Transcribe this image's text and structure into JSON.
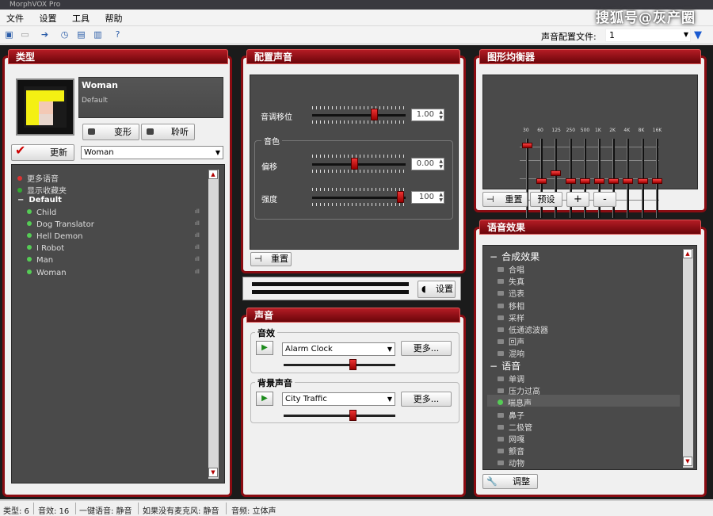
{
  "window": {
    "title": "MorphVOX Pro"
  },
  "watermark": "搜狐号@灰产圈",
  "menu": [
    "文件",
    "设置",
    "工具",
    "帮助"
  ],
  "toolbar": {
    "profile_label": "声音配置文件:",
    "profile_value": "1"
  },
  "type_panel": {
    "title": "类型",
    "voice_name": "Woman",
    "voice_subtitle": "Default",
    "morph_button": "变形",
    "listen_button": "聆听",
    "update_button": "更新",
    "voice_select": "Woman",
    "tree": {
      "more_voices": "更多语音",
      "show_favorites": "显示收藏夹",
      "group": "Default",
      "items": [
        "Child",
        "Dog Translator",
        "Hell Demon",
        "I Robot",
        "Man",
        "Woman"
      ]
    }
  },
  "config_panel": {
    "title": "配置声音",
    "pitch_label": "音调移位",
    "pitch_value": "1.00",
    "pitch_level": 0.68,
    "timbre_group": "音色",
    "bias_label": "偏移",
    "bias_value": "0.00",
    "bias_level": 0.45,
    "strength_label": "强度",
    "strength_value": "100",
    "strength_level": 0.98,
    "reset_button": "重置",
    "settings_button": "设置"
  },
  "sound_panel": {
    "title": "声音",
    "effects_group": "音效",
    "effect_select": "Alarm Clock",
    "effect_more": "更多...",
    "effect_volume": 0.63,
    "bg_group": "背景声音",
    "bg_select": "City Traffic",
    "bg_more": "更多...",
    "bg_volume": 0.63
  },
  "eq_panel": {
    "title": "图形均衡器",
    "bands": [
      {
        "freq": "30",
        "level": 0.95
      },
      {
        "freq": "60",
        "level": 0.48
      },
      {
        "freq": "125",
        "level": 0.58
      },
      {
        "freq": "250",
        "level": 0.48
      },
      {
        "freq": "500",
        "level": 0.48
      },
      {
        "freq": "1K",
        "level": 0.48
      },
      {
        "freq": "2K",
        "level": 0.48
      },
      {
        "freq": "4K",
        "level": 0.48
      },
      {
        "freq": "8K",
        "level": 0.48
      },
      {
        "freq": "16K",
        "level": 0.48
      }
    ],
    "reset_button": "重置",
    "preset_button": "预设",
    "plus_button": "+",
    "minus_button": "-"
  },
  "effects_panel": {
    "title": "语音效果",
    "group1": "合成效果",
    "group1_items": [
      "合唱",
      "失真",
      "迅表",
      "移相",
      "采样",
      "低通滤波器",
      "回声",
      "混响"
    ],
    "group2": "语音",
    "group2_items": [
      "单调",
      "压力过高",
      "喘息声",
      "鼻子",
      "二极管",
      "网嘎",
      "颤音",
      "动物"
    ],
    "tweak_button": "调整"
  },
  "statusbar": {
    "types": "类型: 6",
    "effects": "音效: 16",
    "hotkey": "一键语音: 静音",
    "nomic": "如果没有麦克风: 静音",
    "audio": "音频: 立体声"
  }
}
